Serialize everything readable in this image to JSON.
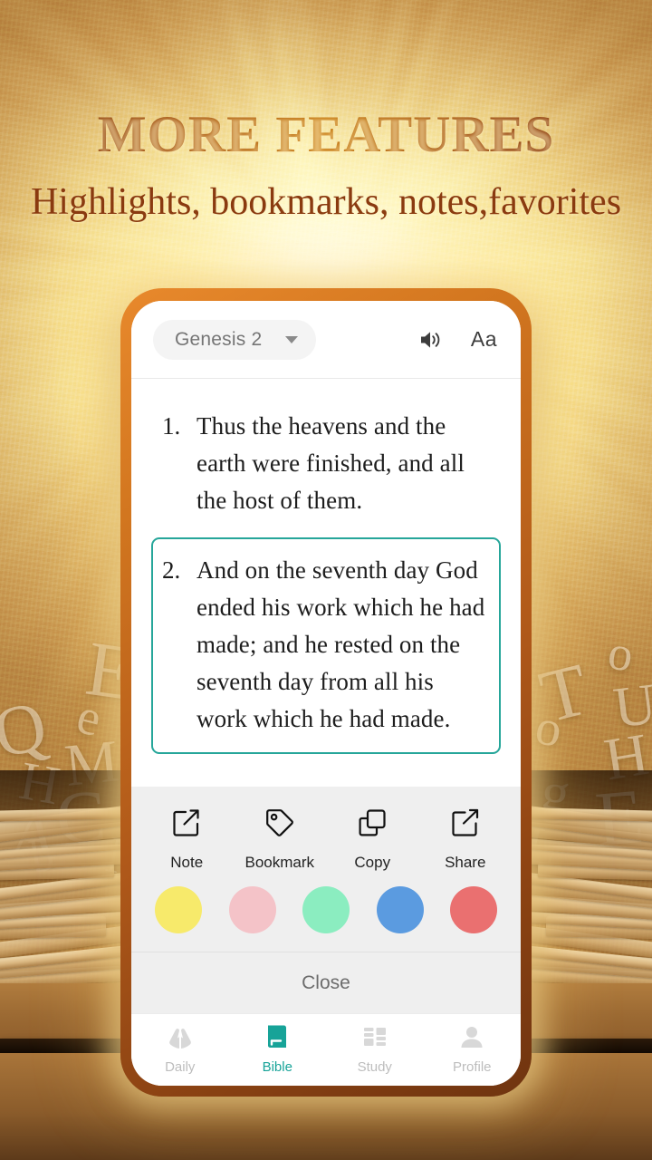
{
  "promo": {
    "headline": "MORE FEATURES",
    "subheadline": "Highlights, bookmarks, notes,favorites",
    "headline_color": "#8a3a10",
    "subheadline_color": "#8a3a10"
  },
  "background": {
    "style": "golden parchment with sunburst rays and open books",
    "floating_letters_left": [
      "Q",
      "E",
      "e",
      "M",
      "H",
      "C",
      "A",
      "b",
      "N"
    ],
    "floating_letters_right": [
      "T",
      "o",
      "U",
      "o",
      "H",
      "g",
      "E",
      "L"
    ]
  },
  "app": {
    "header": {
      "book_chapter": "Genesis 2",
      "dropdown_icon": "chevron-down-icon",
      "audio_icon": "speaker-icon",
      "font_size_label": "Aa"
    },
    "verses": [
      {
        "number": "1.",
        "text": "Thus the heavens and the earth were finished, and all the host of them.",
        "selected": false
      },
      {
        "number": "2.",
        "text": "And on the seventh day God ended his work which he had made; and he rested on the seventh day from all his work which he had made.",
        "selected": true
      }
    ],
    "selection_color": "#26a69a",
    "action_sheet": {
      "actions": [
        {
          "label": "Note",
          "icon": "note-edit-icon"
        },
        {
          "label": "Bookmark",
          "icon": "tag-bookmark-icon"
        },
        {
          "label": "Copy",
          "icon": "copy-icon"
        },
        {
          "label": "Share",
          "icon": "share-icon"
        }
      ],
      "highlight_colors": [
        {
          "name": "yellow",
          "hex": "#F7EA6B"
        },
        {
          "name": "pink",
          "hex": "#F4C3C8"
        },
        {
          "name": "mint",
          "hex": "#8BEDC0"
        },
        {
          "name": "blue",
          "hex": "#5B9BE0"
        },
        {
          "name": "red",
          "hex": "#EA7070"
        }
      ],
      "close_label": "Close"
    },
    "bottom_nav": {
      "active_color": "#17a398",
      "inactive_color": "#bdbdbd",
      "items": [
        {
          "label": "Daily",
          "icon": "praying-hands-icon",
          "active": false
        },
        {
          "label": "Bible",
          "icon": "book-icon",
          "active": true
        },
        {
          "label": "Study",
          "icon": "columns-icon",
          "active": false
        },
        {
          "label": "Profile",
          "icon": "person-icon",
          "active": false
        }
      ]
    }
  }
}
